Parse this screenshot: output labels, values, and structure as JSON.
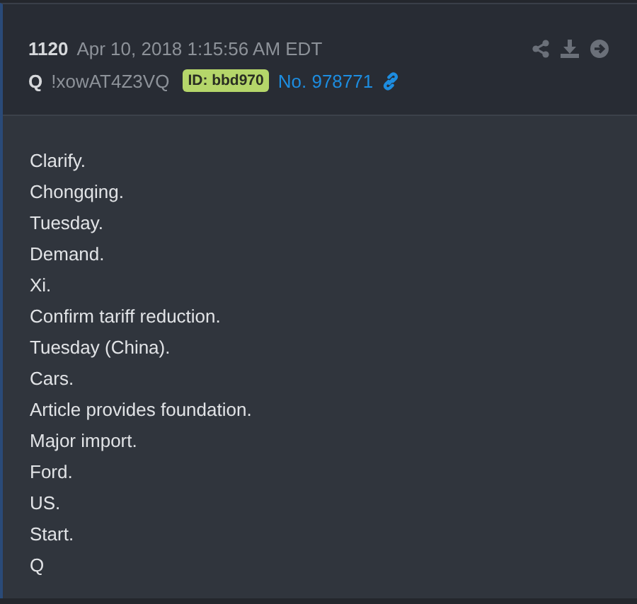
{
  "post": {
    "number": "1120",
    "timestamp": "Apr 10, 2018 1:15:56 AM EDT",
    "author": "Q",
    "tripcode": "!xowAT4Z3VQ",
    "id_badge": "ID: bbd970",
    "post_link": "No. 978771"
  },
  "body_lines": [
    "Clarify.",
    "Chongqing.",
    "Tuesday.",
    "Demand.",
    "Xi.",
    "Confirm tariff reduction.",
    "Tuesday (China).",
    "Cars.",
    "Article provides foundation.",
    "Major import.",
    "Ford.",
    "US.",
    "Start.",
    "Q"
  ]
}
